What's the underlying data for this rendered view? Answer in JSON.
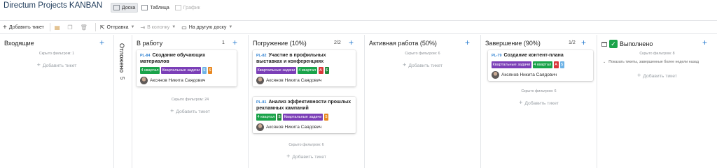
{
  "app": {
    "title": "Directum Projects KANBAN"
  },
  "view_tabs": [
    {
      "label": "Доска",
      "icon": "board-icon",
      "state": "active"
    },
    {
      "label": "Таблица",
      "icon": "table-icon",
      "state": "normal"
    },
    {
      "label": "График",
      "icon": "chart-icon",
      "state": "disabled"
    }
  ],
  "toolbar": {
    "add_ticket": "Добавить тикет",
    "send": "Отправка",
    "to_column": "В колонку",
    "to_other_board": "На другую доску"
  },
  "common": {
    "add_ticket": "Добавить тикет",
    "assignee_name": "Аксянов Никита Саядович"
  },
  "tag_colors": {
    "quarter": "#1aa34a",
    "quarterly_tasks": "#7b3fb7",
    "A": "#d9373a",
    "S_blue": "#6fb3e6",
    "S_orange": "#e8871f",
    "S_green": "#1f8a3a"
  },
  "columns": {
    "incoming": {
      "title": "Входящие",
      "hidden": "Скрыто фильтром: 1"
    },
    "deferred": {
      "title": "Отложено",
      "count": "5"
    },
    "in_work": {
      "title": "В работу",
      "count": "1",
      "hidden": "Скрыто фильтром: 24",
      "cards": [
        {
          "id": "PL-84",
          "title": "Создание обучающих материалов",
          "tags": [
            "4 квартал",
            "Квартальные задачи",
            "$",
            "$"
          ]
        }
      ]
    },
    "immersion": {
      "title": "Погружение (10%)",
      "count": "2/2",
      "hidden": "Скрыто фильтром: 6",
      "cards": [
        {
          "id": "PL-82",
          "title": "Участие в профильных выставках и конференциях",
          "tags": [
            "Квартальные задачи",
            "4 квартал",
            "A",
            "$"
          ]
        },
        {
          "id": "PL-81",
          "title": "Анализ эффективности прошлых рекламных кампаний",
          "tags": [
            "4 квартал",
            "$",
            "Квартальные задачи",
            "$"
          ]
        }
      ]
    },
    "active": {
      "title": "Активная работа (50%)",
      "hidden": "Скрыто фильтром: 6"
    },
    "finishing": {
      "title": "Завершение (90%)",
      "count": "1/2",
      "hidden": "Скрыто фильтром: 6",
      "cards": [
        {
          "id": "PL-79",
          "title": "Создание контент-плана",
          "tags": [
            "Квартальные задачи",
            "4 квартал",
            "A",
            "$"
          ]
        }
      ]
    },
    "done": {
      "title": "Выполнено",
      "hidden": "Скрыто фильтром: 8",
      "show_closed": "Показать тикеты, завершенные более недели назад"
    }
  }
}
